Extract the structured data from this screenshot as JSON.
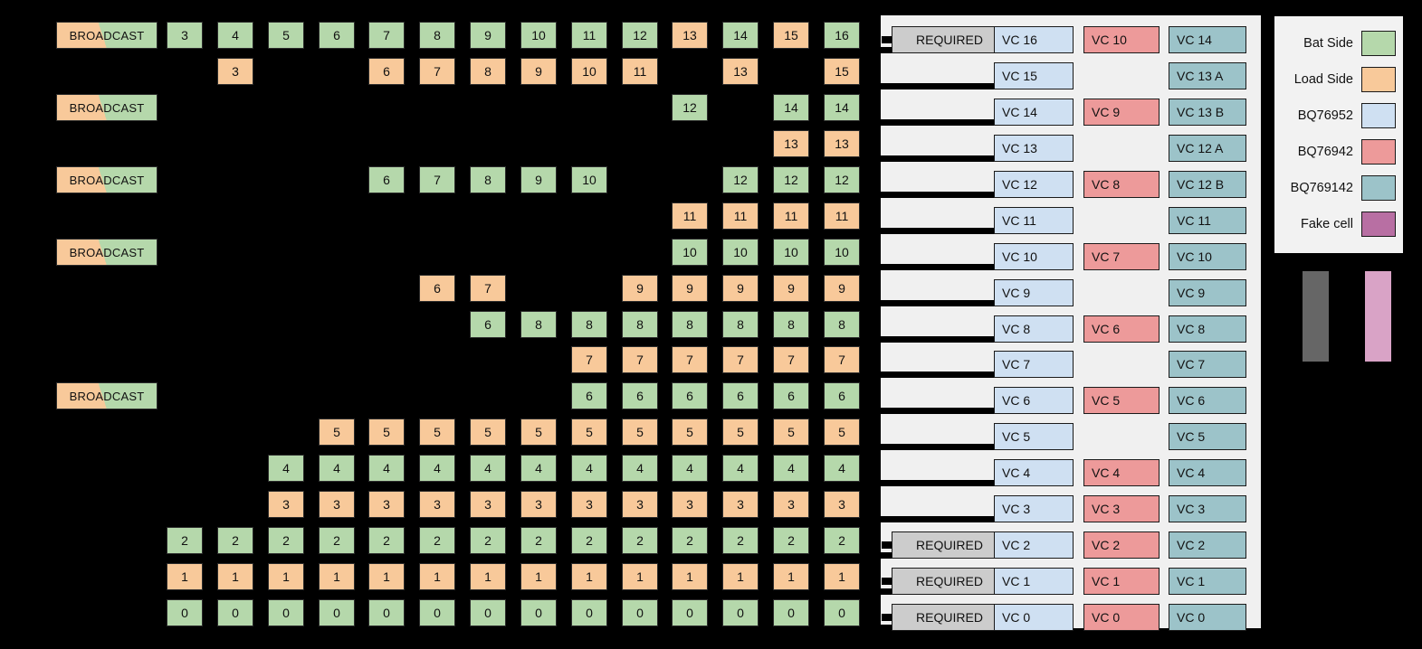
{
  "colors": {
    "bat_side": "#b5d8ab",
    "load_side": "#f8c99a",
    "bq76952": "#cfe0f2",
    "bq76942": "#ed9a9a",
    "bq769142": "#9cc3c9",
    "fake_cell": "#b86fa3",
    "required": "#cccccc",
    "panel_bg": "#f0f0f0",
    "bar_gray": "#666666",
    "bar_pink": "#d9a3c6"
  },
  "matrix": {
    "broadcast_label": "BROADCAST",
    "columns": 14,
    "rows": [
      {
        "broadcast": true,
        "cells": [
          {
            "col": 1,
            "text": "3",
            "side": "bat"
          },
          {
            "col": 2,
            "text": "4",
            "side": "bat"
          },
          {
            "col": 3,
            "text": "5",
            "side": "bat"
          },
          {
            "col": 4,
            "text": "6",
            "side": "bat"
          },
          {
            "col": 5,
            "text": "7",
            "side": "bat"
          },
          {
            "col": 6,
            "text": "8",
            "side": "bat"
          },
          {
            "col": 7,
            "text": "9",
            "side": "bat"
          },
          {
            "col": 8,
            "text": "10",
            "side": "bat"
          },
          {
            "col": 9,
            "text": "11",
            "side": "bat"
          },
          {
            "col": 10,
            "text": "12",
            "side": "bat"
          },
          {
            "col": 11,
            "text": "13",
            "side": "load"
          },
          {
            "col": 12,
            "text": "14",
            "side": "bat"
          },
          {
            "col": 13,
            "text": "15",
            "side": "load"
          },
          {
            "col": 14,
            "text": "16",
            "side": "bat"
          }
        ]
      },
      {
        "broadcast": false,
        "cells": [
          {
            "col": 2,
            "text": "3",
            "side": "load"
          },
          {
            "col": 5,
            "text": "6",
            "side": "load"
          },
          {
            "col": 6,
            "text": "7",
            "side": "load"
          },
          {
            "col": 7,
            "text": "8",
            "side": "load"
          },
          {
            "col": 8,
            "text": "9",
            "side": "load"
          },
          {
            "col": 9,
            "text": "10",
            "side": "load"
          },
          {
            "col": 10,
            "text": "11",
            "side": "load"
          },
          {
            "col": 12,
            "text": "13",
            "side": "load"
          },
          {
            "col": 14,
            "text": "15",
            "side": "load"
          }
        ]
      },
      {
        "broadcast": true,
        "cells": [
          {
            "col": 11,
            "text": "12",
            "side": "bat"
          },
          {
            "col": 13,
            "text": "14",
            "side": "bat"
          },
          {
            "col": 14,
            "text": "14",
            "side": "bat"
          }
        ]
      },
      {
        "broadcast": false,
        "cells": [
          {
            "col": 13,
            "text": "13",
            "side": "load"
          },
          {
            "col": 14,
            "text": "13",
            "side": "load"
          }
        ]
      },
      {
        "broadcast": true,
        "cells": [
          {
            "col": 5,
            "text": "6",
            "side": "bat"
          },
          {
            "col": 6,
            "text": "7",
            "side": "bat"
          },
          {
            "col": 7,
            "text": "8",
            "side": "bat"
          },
          {
            "col": 8,
            "text": "9",
            "side": "bat"
          },
          {
            "col": 9,
            "text": "10",
            "side": "bat"
          },
          {
            "col": 12,
            "text": "12",
            "side": "bat"
          },
          {
            "col": 13,
            "text": "12",
            "side": "bat"
          },
          {
            "col": 14,
            "text": "12",
            "side": "bat"
          }
        ]
      },
      {
        "broadcast": false,
        "cells": [
          {
            "col": 11,
            "text": "11",
            "side": "load"
          },
          {
            "col": 12,
            "text": "11",
            "side": "load"
          },
          {
            "col": 13,
            "text": "11",
            "side": "load"
          },
          {
            "col": 14,
            "text": "11",
            "side": "load"
          }
        ]
      },
      {
        "broadcast": true,
        "cells": [
          {
            "col": 11,
            "text": "10",
            "side": "bat"
          },
          {
            "col": 12,
            "text": "10",
            "side": "bat"
          },
          {
            "col": 13,
            "text": "10",
            "side": "bat"
          },
          {
            "col": 14,
            "text": "10",
            "side": "bat"
          }
        ]
      },
      {
        "broadcast": false,
        "cells": [
          {
            "col": 6,
            "text": "6",
            "side": "load"
          },
          {
            "col": 7,
            "text": "7",
            "side": "load"
          },
          {
            "col": 10,
            "text": "9",
            "side": "load"
          },
          {
            "col": 11,
            "text": "9",
            "side": "load"
          },
          {
            "col": 12,
            "text": "9",
            "side": "load"
          },
          {
            "col": 13,
            "text": "9",
            "side": "load"
          },
          {
            "col": 14,
            "text": "9",
            "side": "load"
          }
        ]
      },
      {
        "broadcast": false,
        "cells": [
          {
            "col": 7,
            "text": "6",
            "side": "bat"
          },
          {
            "col": 8,
            "text": "8",
            "side": "bat"
          },
          {
            "col": 9,
            "text": "8",
            "side": "bat"
          },
          {
            "col": 10,
            "text": "8",
            "side": "bat"
          },
          {
            "col": 11,
            "text": "8",
            "side": "bat"
          },
          {
            "col": 12,
            "text": "8",
            "side": "bat"
          },
          {
            "col": 13,
            "text": "8",
            "side": "bat"
          },
          {
            "col": 14,
            "text": "8",
            "side": "bat"
          }
        ]
      },
      {
        "broadcast": false,
        "cells": [
          {
            "col": 9,
            "text": "7",
            "side": "load"
          },
          {
            "col": 10,
            "text": "7",
            "side": "load"
          },
          {
            "col": 11,
            "text": "7",
            "side": "load"
          },
          {
            "col": 12,
            "text": "7",
            "side": "load"
          },
          {
            "col": 13,
            "text": "7",
            "side": "load"
          },
          {
            "col": 14,
            "text": "7",
            "side": "load"
          }
        ]
      },
      {
        "broadcast": true,
        "cells": [
          {
            "col": 9,
            "text": "6",
            "side": "bat"
          },
          {
            "col": 10,
            "text": "6",
            "side": "bat"
          },
          {
            "col": 11,
            "text": "6",
            "side": "bat"
          },
          {
            "col": 12,
            "text": "6",
            "side": "bat"
          },
          {
            "col": 13,
            "text": "6",
            "side": "bat"
          },
          {
            "col": 14,
            "text": "6",
            "side": "bat"
          }
        ]
      },
      {
        "broadcast": false,
        "cells": [
          {
            "col": 4,
            "text": "5",
            "side": "load"
          },
          {
            "col": 5,
            "text": "5",
            "side": "load"
          },
          {
            "col": 6,
            "text": "5",
            "side": "load"
          },
          {
            "col": 7,
            "text": "5",
            "side": "load"
          },
          {
            "col": 8,
            "text": "5",
            "side": "load"
          },
          {
            "col": 9,
            "text": "5",
            "side": "load"
          },
          {
            "col": 10,
            "text": "5",
            "side": "load"
          },
          {
            "col": 11,
            "text": "5",
            "side": "load"
          },
          {
            "col": 12,
            "text": "5",
            "side": "load"
          },
          {
            "col": 13,
            "text": "5",
            "side": "load"
          },
          {
            "col": 14,
            "text": "5",
            "side": "load"
          }
        ]
      },
      {
        "broadcast": false,
        "cells": [
          {
            "col": 3,
            "text": "4",
            "side": "bat"
          },
          {
            "col": 4,
            "text": "4",
            "side": "bat"
          },
          {
            "col": 5,
            "text": "4",
            "side": "bat"
          },
          {
            "col": 6,
            "text": "4",
            "side": "bat"
          },
          {
            "col": 7,
            "text": "4",
            "side": "bat"
          },
          {
            "col": 8,
            "text": "4",
            "side": "bat"
          },
          {
            "col": 9,
            "text": "4",
            "side": "bat"
          },
          {
            "col": 10,
            "text": "4",
            "side": "bat"
          },
          {
            "col": 11,
            "text": "4",
            "side": "bat"
          },
          {
            "col": 12,
            "text": "4",
            "side": "bat"
          },
          {
            "col": 13,
            "text": "4",
            "side": "bat"
          },
          {
            "col": 14,
            "text": "4",
            "side": "bat"
          }
        ]
      },
      {
        "broadcast": false,
        "cells": [
          {
            "col": 3,
            "text": "3",
            "side": "load"
          },
          {
            "col": 4,
            "text": "3",
            "side": "load"
          },
          {
            "col": 5,
            "text": "3",
            "side": "load"
          },
          {
            "col": 6,
            "text": "3",
            "side": "load"
          },
          {
            "col": 7,
            "text": "3",
            "side": "load"
          },
          {
            "col": 8,
            "text": "3",
            "side": "load"
          },
          {
            "col": 9,
            "text": "3",
            "side": "load"
          },
          {
            "col": 10,
            "text": "3",
            "side": "load"
          },
          {
            "col": 11,
            "text": "3",
            "side": "load"
          },
          {
            "col": 12,
            "text": "3",
            "side": "load"
          },
          {
            "col": 13,
            "text": "3",
            "side": "load"
          },
          {
            "col": 14,
            "text": "3",
            "side": "load"
          }
        ]
      },
      {
        "broadcast": false,
        "cells": [
          {
            "col": 1,
            "text": "2",
            "side": "bat"
          },
          {
            "col": 2,
            "text": "2",
            "side": "bat"
          },
          {
            "col": 3,
            "text": "2",
            "side": "bat"
          },
          {
            "col": 4,
            "text": "2",
            "side": "bat"
          },
          {
            "col": 5,
            "text": "2",
            "side": "bat"
          },
          {
            "col": 6,
            "text": "2",
            "side": "bat"
          },
          {
            "col": 7,
            "text": "2",
            "side": "bat"
          },
          {
            "col": 8,
            "text": "2",
            "side": "bat"
          },
          {
            "col": 9,
            "text": "2",
            "side": "bat"
          },
          {
            "col": 10,
            "text": "2",
            "side": "bat"
          },
          {
            "col": 11,
            "text": "2",
            "side": "bat"
          },
          {
            "col": 12,
            "text": "2",
            "side": "bat"
          },
          {
            "col": 13,
            "text": "2",
            "side": "bat"
          },
          {
            "col": 14,
            "text": "2",
            "side": "bat"
          }
        ]
      },
      {
        "broadcast": false,
        "cells": [
          {
            "col": 1,
            "text": "1",
            "side": "load"
          },
          {
            "col": 2,
            "text": "1",
            "side": "load"
          },
          {
            "col": 3,
            "text": "1",
            "side": "load"
          },
          {
            "col": 4,
            "text": "1",
            "side": "load"
          },
          {
            "col": 5,
            "text": "1",
            "side": "load"
          },
          {
            "col": 6,
            "text": "1",
            "side": "load"
          },
          {
            "col": 7,
            "text": "1",
            "side": "load"
          },
          {
            "col": 8,
            "text": "1",
            "side": "load"
          },
          {
            "col": 9,
            "text": "1",
            "side": "load"
          },
          {
            "col": 10,
            "text": "1",
            "side": "load"
          },
          {
            "col": 11,
            "text": "1",
            "side": "load"
          },
          {
            "col": 12,
            "text": "1",
            "side": "load"
          },
          {
            "col": 13,
            "text": "1",
            "side": "load"
          },
          {
            "col": 14,
            "text": "1",
            "side": "load"
          }
        ]
      },
      {
        "broadcast": false,
        "cells": [
          {
            "col": 1,
            "text": "0",
            "side": "bat"
          },
          {
            "col": 2,
            "text": "0",
            "side": "bat"
          },
          {
            "col": 3,
            "text": "0",
            "side": "bat"
          },
          {
            "col": 4,
            "text": "0",
            "side": "bat"
          },
          {
            "col": 5,
            "text": "0",
            "side": "bat"
          },
          {
            "col": 6,
            "text": "0",
            "side": "bat"
          },
          {
            "col": 7,
            "text": "0",
            "side": "bat"
          },
          {
            "col": 8,
            "text": "0",
            "side": "bat"
          },
          {
            "col": 9,
            "text": "0",
            "side": "bat"
          },
          {
            "col": 10,
            "text": "0",
            "side": "bat"
          },
          {
            "col": 11,
            "text": "0",
            "side": "bat"
          },
          {
            "col": 12,
            "text": "0",
            "side": "bat"
          },
          {
            "col": 13,
            "text": "0",
            "side": "bat"
          },
          {
            "col": 14,
            "text": "0",
            "side": "bat"
          }
        ]
      }
    ]
  },
  "panel": {
    "required_label": "REQUIRED",
    "rows": [
      {
        "required": true,
        "c952": "VC 16",
        "c942": "VC 10",
        "c9142": "VC 14"
      },
      {
        "required": false,
        "c952": "VC 15",
        "c942": null,
        "c9142": "VC 13 A"
      },
      {
        "required": false,
        "c952": "VC 14",
        "c942": "VC 9",
        "c9142": "VC 13 B"
      },
      {
        "required": false,
        "c952": "VC 13",
        "c942": null,
        "c9142": "VC 12 A"
      },
      {
        "required": false,
        "c952": "VC 12",
        "c942": "VC 8",
        "c9142": "VC 12 B"
      },
      {
        "required": false,
        "c952": "VC 11",
        "c942": null,
        "c9142": "VC 11"
      },
      {
        "required": false,
        "c952": "VC 10",
        "c942": "VC 7",
        "c9142": "VC 10"
      },
      {
        "required": false,
        "c952": "VC 9",
        "c942": null,
        "c9142": "VC 9"
      },
      {
        "required": false,
        "c952": "VC 8",
        "c942": "VC 6",
        "c9142": "VC 8"
      },
      {
        "required": false,
        "c952": "VC 7",
        "c942": null,
        "c9142": "VC 7"
      },
      {
        "required": false,
        "c952": "VC 6",
        "c942": "VC 5",
        "c9142": "VC 6"
      },
      {
        "required": false,
        "c952": "VC 5",
        "c942": null,
        "c9142": "VC 5"
      },
      {
        "required": false,
        "c952": "VC 4",
        "c942": "VC 4",
        "c9142": "VC 4"
      },
      {
        "required": false,
        "c952": "VC 3",
        "c942": "VC 3",
        "c9142": "VC 3"
      },
      {
        "required": true,
        "c952": "VC 2",
        "c942": "VC 2",
        "c9142": "VC 2"
      },
      {
        "required": true,
        "c952": "VC 1",
        "c942": "VC 1",
        "c9142": "VC 1"
      },
      {
        "required": true,
        "c952": "VC 0",
        "c942": "VC 0",
        "c9142": "VC 0"
      }
    ]
  },
  "legend": {
    "items": [
      {
        "label": "Bat Side",
        "color": "#b5d8ab"
      },
      {
        "label": "Load Side",
        "color": "#f8c99a"
      },
      {
        "label": "BQ76952",
        "color": "#cfe0f2"
      },
      {
        "label": "BQ76942",
        "color": "#ed9a9a"
      },
      {
        "label": "BQ769142",
        "color": "#9cc3c9"
      },
      {
        "label": "Fake cell",
        "color": "#b86fa3"
      }
    ]
  }
}
